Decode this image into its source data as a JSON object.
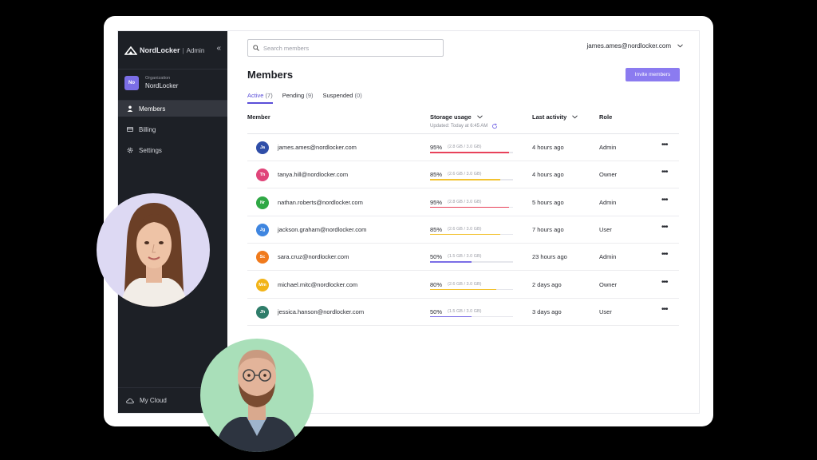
{
  "brand": {
    "name": "NordLocker",
    "sub": "Admin"
  },
  "organization": {
    "label": "Organization",
    "badge": "No",
    "name": "NordLocker"
  },
  "nav": [
    {
      "label": "Members",
      "icon": "user-icon",
      "active": true
    },
    {
      "label": "Billing",
      "icon": "card-icon",
      "active": false
    },
    {
      "label": "Settings",
      "icon": "gear-icon",
      "active": false
    }
  ],
  "footer_nav": {
    "label": "My Cloud",
    "icon": "cloud-icon"
  },
  "search": {
    "placeholder": "Search members",
    "value": ""
  },
  "account": {
    "email": "james.ames@nordlocker.com"
  },
  "page": {
    "title": "Members",
    "invite_label": "Invite members"
  },
  "tabs": [
    {
      "label": "Active",
      "count": "(7)",
      "active": true
    },
    {
      "label": "Pending",
      "count": "(9)",
      "active": false
    },
    {
      "label": "Suspended",
      "count": "(0)",
      "active": false
    }
  ],
  "columns": {
    "member": "Member",
    "storage": "Storage usage",
    "activity": "Last activity",
    "role": "Role",
    "updated": "Updated: Today at 6:45 AM"
  },
  "members": [
    {
      "initials": "Ja",
      "avatar_color": "#2f4ea8",
      "email": "james.ames@nordlocker.com",
      "pct": "95%",
      "size": "(2.8 GB / 3.0 GB)",
      "usage": 0.95,
      "bar_color": "#e8425b",
      "activity": "4 hours ago",
      "role": "Admin"
    },
    {
      "initials": "Th",
      "avatar_color": "#e0457a",
      "email": "tanya.hill@nordlocker.com",
      "pct": "85%",
      "size": "(2.6 GB / 3.0 GB)",
      "usage": 0.85,
      "bar_color": "#f2c230",
      "activity": "4 hours ago",
      "role": "Owner"
    },
    {
      "initials": "Nr",
      "avatar_color": "#2fa845",
      "email": "nathan.roberts@nordlocker.com",
      "pct": "95%",
      "size": "(2.8 GB / 3.0 GB)",
      "usage": 0.95,
      "bar_color": "#e8425b",
      "activity": "5 hours ago",
      "role": "Admin"
    },
    {
      "initials": "Jg",
      "avatar_color": "#3f86e0",
      "email": "jackson.graham@nordlocker.com",
      "pct": "85%",
      "size": "(2.6 GB / 3.0 GB)",
      "usage": 0.85,
      "bar_color": "#f2c230",
      "activity": "7 hours ago",
      "role": "User"
    },
    {
      "initials": "Sc",
      "avatar_color": "#f07a1c",
      "email": "sara.cruz@nordlocker.com",
      "pct": "50%",
      "size": "(1.5 GB / 3.0 GB)",
      "usage": 0.5,
      "bar_color": "#7b6ee6",
      "activity": "23 hours ago",
      "role": "Admin"
    },
    {
      "initials": "Mm",
      "avatar_color": "#f2b418",
      "email": "michael.mitc@nordlocker.com",
      "pct": "80%",
      "size": "(2.6 GB / 3.0 GB)",
      "usage": 0.8,
      "bar_color": "#f2c230",
      "activity": "2 days ago",
      "role": "Owner"
    },
    {
      "initials": "Jh",
      "avatar_color": "#2f7d6a",
      "email": "jessica.hanson@nordlocker.com",
      "pct": "50%",
      "size": "(1.5 GB / 3.0 GB)",
      "usage": 0.5,
      "bar_color": "#7b6ee6",
      "activity": "3 days ago",
      "role": "User"
    }
  ],
  "colors": {
    "accent": "#8b7bf0",
    "sidebar": "#1d2026",
    "photo1_bg": "#ddd9f3",
    "photo2_bg": "#a9dfb9"
  }
}
